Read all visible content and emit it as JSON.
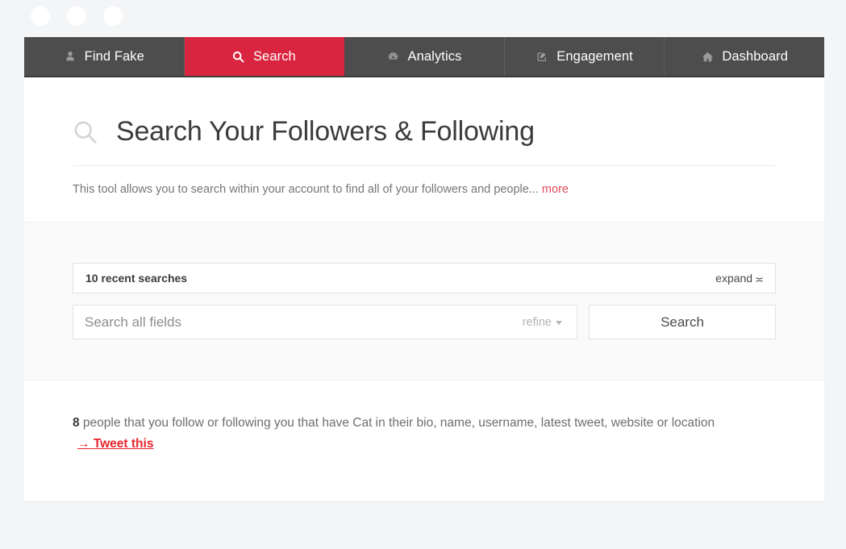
{
  "window_chrome": {
    "dots": [
      "dot-1",
      "dot-2",
      "dot-3"
    ]
  },
  "nav": {
    "tabs": [
      {
        "label": "Find Fake",
        "icon": "user-icon",
        "active": false
      },
      {
        "label": "Search",
        "icon": "search-icon",
        "active": true
      },
      {
        "label": "Analytics",
        "icon": "dashboard-icon",
        "active": false
      },
      {
        "label": "Engagement",
        "icon": "edit-square-icon",
        "active": false
      },
      {
        "label": "Dashboard",
        "icon": "home-icon",
        "active": false
      }
    ]
  },
  "page": {
    "title": "Search Your Followers & Following",
    "title_icon": "search-icon",
    "intro": "This tool allows you to search within your account to find all of your followers and people...",
    "intro_more": "more"
  },
  "search_panel": {
    "recent_label": "10 recent searches",
    "expand_label": "expand",
    "expand_icon": "chevron-double-down-icon",
    "input_placeholder": "Search all fields",
    "input_value": "",
    "refine_label": "refine",
    "refine_icon": "caret-down-icon",
    "search_button": "Search"
  },
  "results": {
    "count": "8",
    "description": " people that you follow or following you that have Cat in their bio, name, username, latest tweet, website or location",
    "tweet_link": "Tweet this",
    "tweet_arrow": "→"
  },
  "colors": {
    "accent_red": "#d9253f",
    "nav_bg": "#4d4d4d",
    "link_red": "#e8232b",
    "page_bg": "#f4f5f7",
    "panel_gray": "#fafafb"
  }
}
